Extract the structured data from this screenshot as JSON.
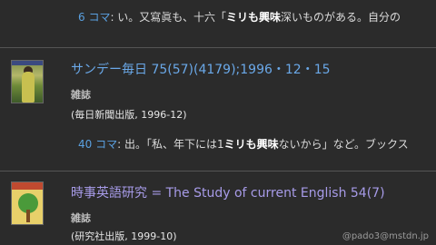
{
  "results": [
    {
      "snippet": {
        "link": "6 コマ",
        "pre": ": い。又寫眞も、十六「",
        "hit": "ミリ",
        "mid": "も",
        "hit2": "興味",
        "post": "深いものがある。自分の"
      }
    },
    {
      "title": "サンデー毎日 75(57)(4179);1996・12・15",
      "type": "雑誌",
      "publisher": "(毎日新聞出版, 1996-12)",
      "snippet": {
        "link": "40 コマ",
        "pre": ": 出。「私、年下には1",
        "hit": "ミリ",
        "mid": "も",
        "hit2": "興味",
        "post": "ないから」など。ブックス"
      }
    },
    {
      "title": "時事英語研究 = The Study of current English 54(7)",
      "type": "雑誌",
      "publisher": "(研究社出版, 1999-10)"
    }
  ],
  "watermark": "@pado3@mstdn.jp"
}
